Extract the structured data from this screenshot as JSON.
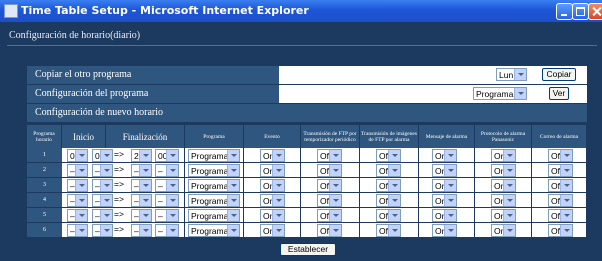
{
  "window": {
    "title": "Time Table Setup - Microsoft Internet Explorer"
  },
  "page": {
    "heading": "Configuración de horario(diario)"
  },
  "copy_row": {
    "label": "Copiar el otro programa",
    "day_value": "Lun",
    "button": "Copiar"
  },
  "program_row": {
    "label": "Configuración del programa",
    "program_value": "Programa1",
    "button": "Ver"
  },
  "new_schedule": {
    "label": "Configuración de nuevo horario"
  },
  "table": {
    "headers": {
      "program_schedule": "Programa horario",
      "start": "Inicio",
      "end": "Finalización",
      "program": "Programa",
      "event": "Evento",
      "ftp_periodic": "Transmisión de FTP por temporizador periódico",
      "ftp_alarm": "Transmisión de imágenes de FTP por alarma",
      "alarm_message": "Mensaje de alarma",
      "panasonic_protocol": "Protocolo de alarma Panasonic",
      "alarm_mail": "Correo de alarma"
    },
    "arrow": "=>",
    "rows": [
      {
        "n": "1",
        "sh": "0",
        "sm": "00",
        "eh": "24",
        "em": "00",
        "program": "Programa1",
        "event": "On",
        "ftp_periodic": "Off",
        "ftp_alarm": "Off",
        "alarm_message": "On",
        "panasonic": "On",
        "alarm_mail": "Off"
      },
      {
        "n": "2",
        "sh": "–",
        "sm": "–",
        "eh": "–",
        "em": "–",
        "program": "Programa1",
        "event": "On",
        "ftp_periodic": "Off",
        "ftp_alarm": "Off",
        "alarm_message": "On",
        "panasonic": "On",
        "alarm_mail": "Off"
      },
      {
        "n": "3",
        "sh": "–",
        "sm": "–",
        "eh": "–",
        "em": "–",
        "program": "Programa1",
        "event": "On",
        "ftp_periodic": "Off",
        "ftp_alarm": "Off",
        "alarm_message": "On",
        "panasonic": "On",
        "alarm_mail": "Off"
      },
      {
        "n": "4",
        "sh": "–",
        "sm": "–",
        "eh": "–",
        "em": "–",
        "program": "Programa1",
        "event": "On",
        "ftp_periodic": "Off",
        "ftp_alarm": "Off",
        "alarm_message": "On",
        "panasonic": "On",
        "alarm_mail": "Off"
      },
      {
        "n": "5",
        "sh": "–",
        "sm": "–",
        "eh": "–",
        "em": "–",
        "program": "Programa1",
        "event": "On",
        "ftp_periodic": "Off",
        "ftp_alarm": "Off",
        "alarm_message": "On",
        "panasonic": "On",
        "alarm_mail": "Off"
      },
      {
        "n": "6",
        "sh": "–",
        "sm": "–",
        "eh": "–",
        "em": "–",
        "program": "Programa1",
        "event": "On",
        "ftp_periodic": "Off",
        "ftp_alarm": "Off",
        "alarm_message": "On",
        "panasonic": "On",
        "alarm_mail": "Off"
      }
    ]
  },
  "actions": {
    "set_button": "Establecer"
  }
}
